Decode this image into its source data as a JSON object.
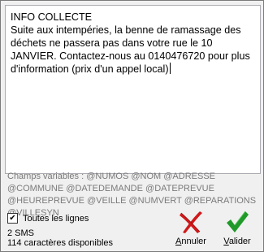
{
  "message": {
    "text": "INFO COLLECTE\nSuite aux intempéries, la benne de ramassage des déchets ne passera pas dans votre rue le 10 JANVIER. Contactez-nous au 0140476720 pour plus d'information (prix d'un appel local)"
  },
  "variables": {
    "text": "Champs variables : @NUMOS @NOM @ADRESSE @COMMUNE @DATEDEMANDE @DATEPREVUE @HEUREPREVUE @VEILLE @NUMVERT @REPARATIONS @VILLESYN"
  },
  "options": {
    "all_lines_label": "Toutes les lignes",
    "all_lines_checked": true,
    "check_glyph": "✔"
  },
  "status": {
    "sms_count": "2 SMS",
    "chars_available": "114 caractères disponibles"
  },
  "buttons": {
    "cancel_label": "Annuler",
    "cancel_underline": "A",
    "cancel_rest": "nnuler",
    "ok_label": "Valider",
    "ok_underline": "V",
    "ok_rest": "alider"
  },
  "colors": {
    "cancel_icon": "#d0191b",
    "ok_icon": "#1f9a2a",
    "variables_text": "#7a7a7a"
  },
  "icons": {
    "cancel": "red-x-icon",
    "ok": "green-check-icon"
  }
}
